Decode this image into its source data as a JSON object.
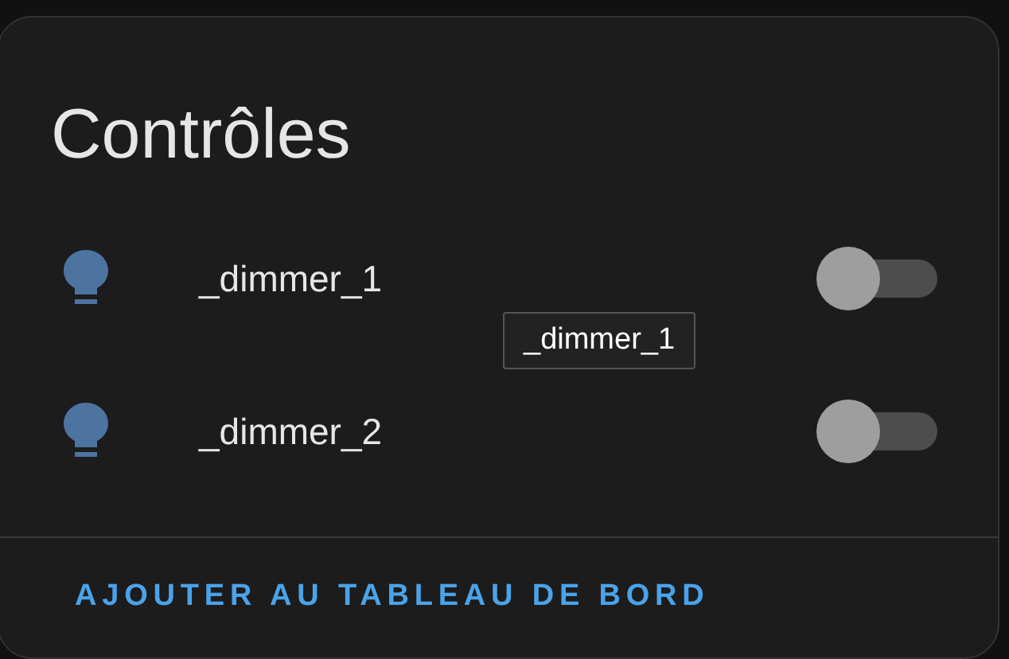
{
  "card": {
    "title": "Contrôles",
    "entities": [
      {
        "name": "_dimmer_1",
        "on": false
      },
      {
        "name": "_dimmer_2",
        "on": false
      }
    ],
    "tooltip": "_dimmer_1",
    "action": "AJOUTER AU TABLEAU DE BORD"
  }
}
